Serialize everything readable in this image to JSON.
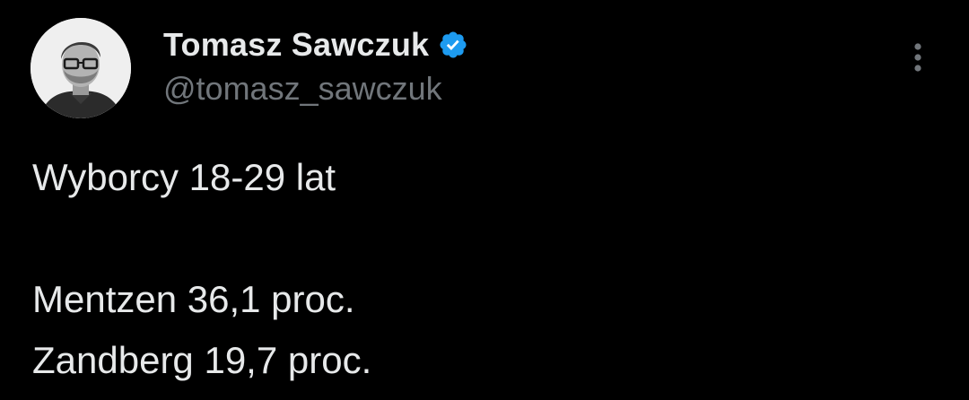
{
  "author": {
    "display_name": "Tomasz Sawczuk",
    "handle": "@tomasz_sawczuk",
    "verified": true,
    "verified_color": "#1d9bf0",
    "avatar_icon": "profile-photo-avatar"
  },
  "tweet": {
    "lines": [
      "Wyborcy 18-29 lat",
      "",
      "Mentzen 36,1 proc.",
      "Zandberg 19,7 proc."
    ]
  },
  "menu": {
    "icon": "more-vertical-icon"
  },
  "colors": {
    "background": "#000000",
    "text_primary": "#e7e9ea",
    "text_secondary": "#71767b"
  }
}
